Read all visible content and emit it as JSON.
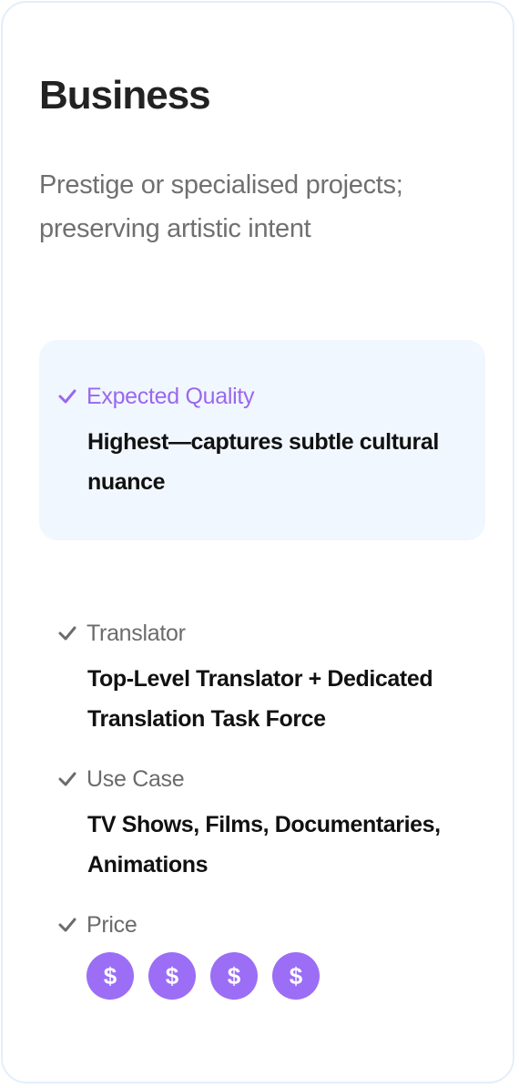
{
  "plan": {
    "title": "Business",
    "subtitle": "Prestige or specialised projects; preserving artistic intent"
  },
  "features": {
    "quality": {
      "label": "Expected Quality",
      "value": "Highest—captures subtle cultural nuance"
    },
    "translator": {
      "label": "Translator",
      "value": "Top-Level Translator + Dedicated Translation Task Force"
    },
    "use_case": {
      "label": "Use Case",
      "value": "TV Shows, Films, Documentaries, Animations"
    },
    "price": {
      "label": "Price",
      "level": 4,
      "max": 4,
      "symbol": "$"
    }
  },
  "colors": {
    "accent": "#9b6ef5",
    "highlight_bg": "#f1f7fe",
    "border": "#e3eefb"
  },
  "icons": {
    "check": "check-icon",
    "coin": "dollar-coin-icon"
  }
}
